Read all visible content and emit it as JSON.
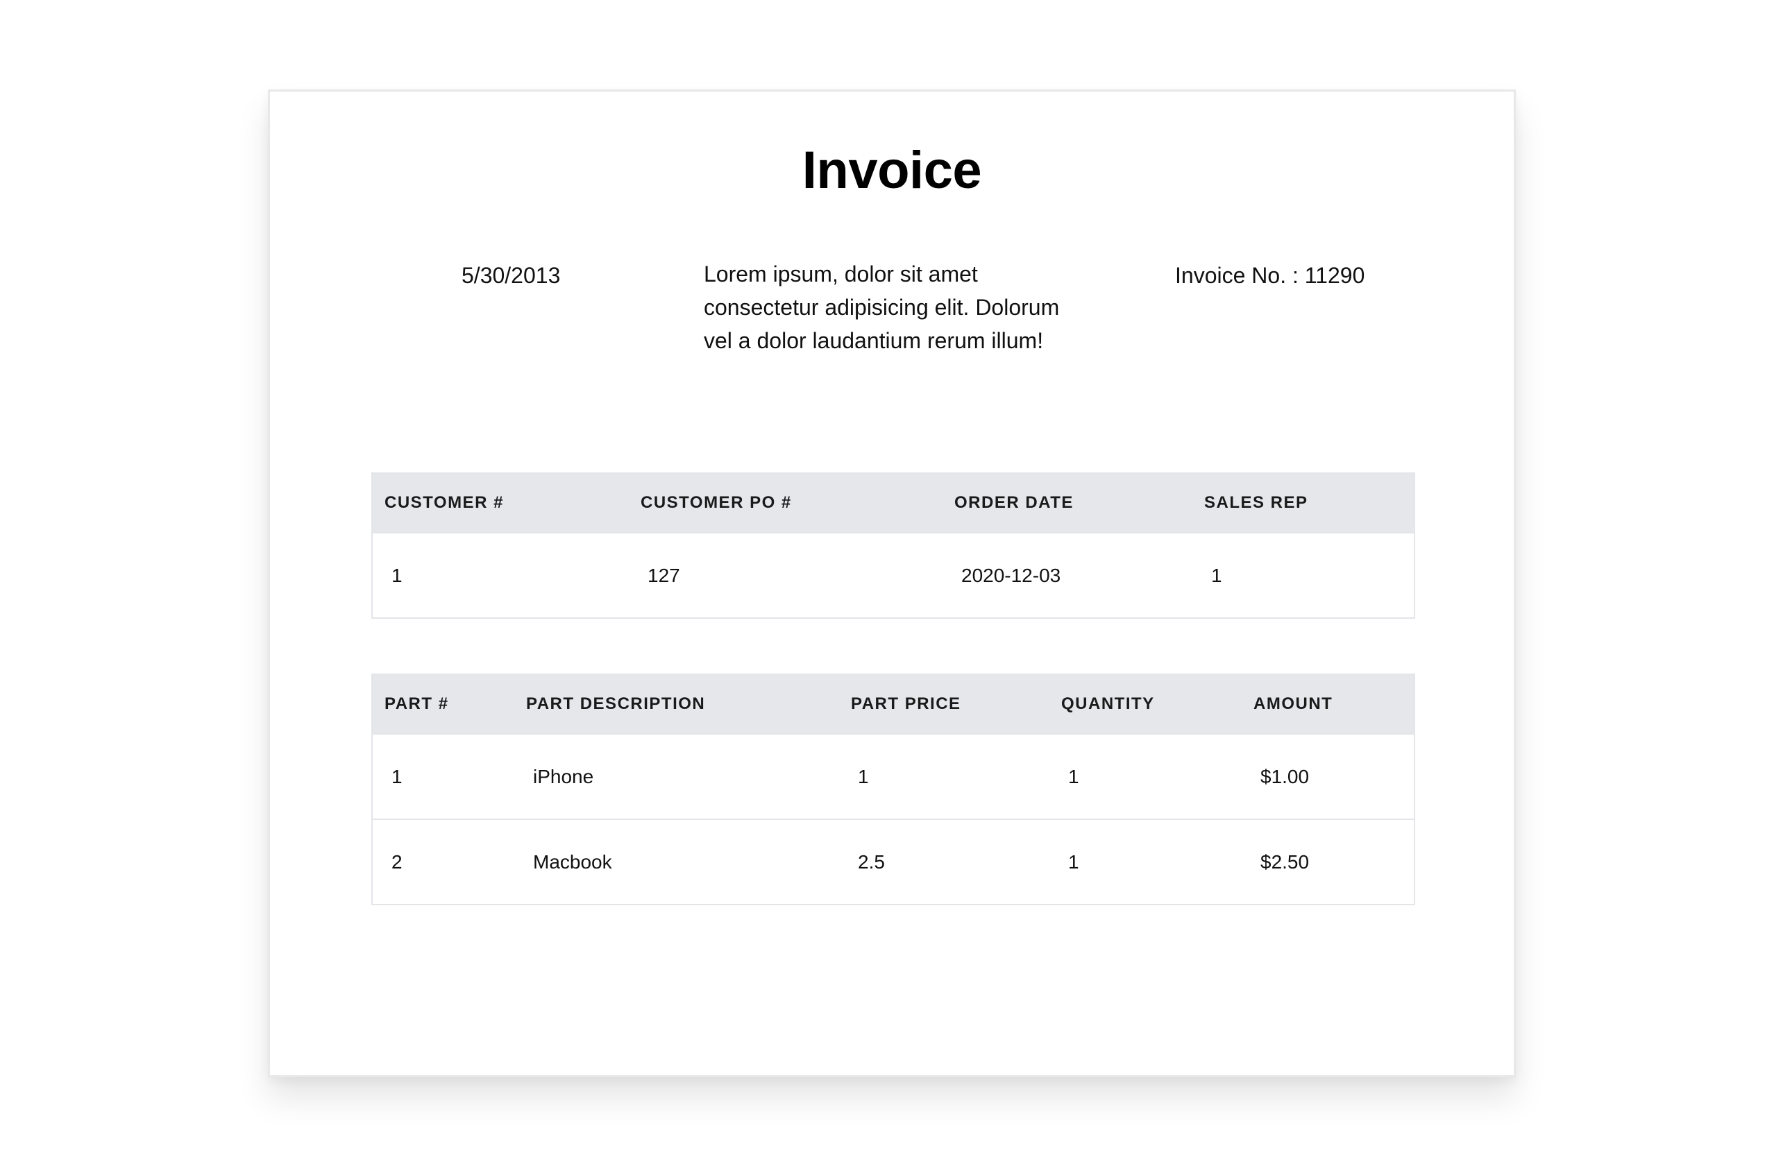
{
  "invoice": {
    "title": "Invoice",
    "date": "5/30/2013",
    "description": "Lorem ipsum, dolor sit amet consectetur adipisicing elit. Dolorum vel a dolor laudantium rerum illum!",
    "invoice_number": "Invoice No. : 11290"
  },
  "order_table": {
    "headers": [
      "CUSTOMER #",
      "CUSTOMER PO #",
      "ORDER DATE",
      "SALES REP"
    ],
    "rows": [
      [
        "1",
        "127",
        "2020-12-03",
        "1"
      ]
    ]
  },
  "parts_table": {
    "headers": [
      "PART #",
      "PART DESCRIPTION",
      "PART PRICE",
      "QUANTITY",
      "AMOUNT"
    ],
    "rows": [
      [
        "1",
        "iPhone",
        "1",
        "1",
        "$1.00"
      ],
      [
        "2",
        "Macbook",
        "2.5",
        "1",
        "$2.50"
      ]
    ]
  }
}
